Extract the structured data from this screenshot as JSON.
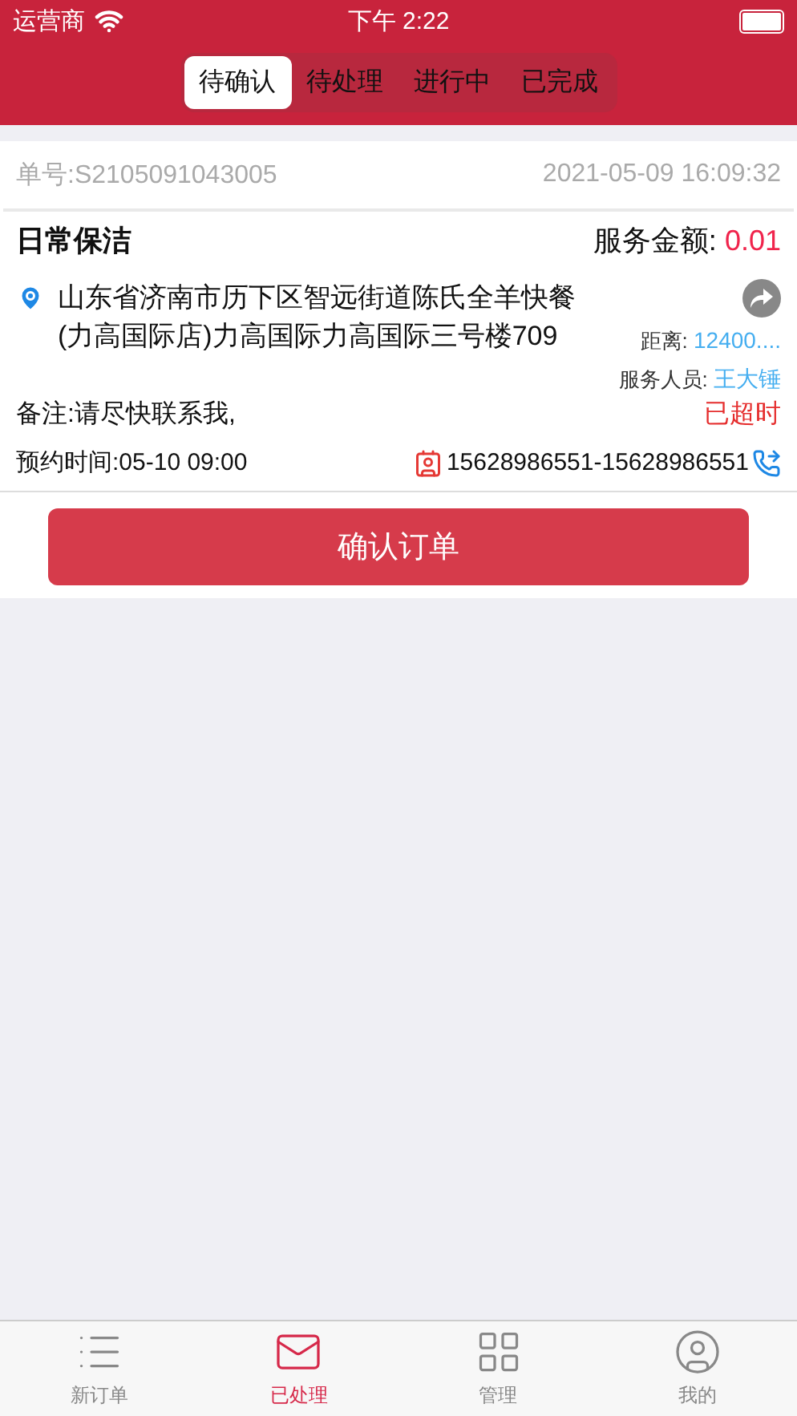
{
  "status_bar": {
    "carrier": "运营商",
    "time": "下午 2:22"
  },
  "segments": [
    {
      "label": "待确认",
      "selected": true
    },
    {
      "label": "待处理",
      "selected": false
    },
    {
      "label": "进行中",
      "selected": false
    },
    {
      "label": "已完成",
      "selected": false
    }
  ],
  "order": {
    "number": "单号:S2105091043005",
    "created": "2021-05-09 16:09:32",
    "service": "日常保洁",
    "amount_label": "服务金额:",
    "amount": "0.01",
    "address": "山东省济南市历下区智远街道陈氏全羊快餐(力高国际店)力高国际力高国际三号楼709",
    "distance_label": "距离:",
    "distance": "12400....",
    "staff_label": "服务人员:",
    "staff": "王大锤",
    "note": "备注:请尽快联系我,",
    "overdue": "已超时",
    "appointment": "预约时间:05-10 09:00",
    "phone": "15628986551-15628986551",
    "confirm_button": "确认订单"
  },
  "tab_bar": [
    {
      "label": "新订单",
      "selected": false,
      "kind": "list"
    },
    {
      "label": "已处理",
      "selected": true,
      "kind": "mail"
    },
    {
      "label": "管理",
      "selected": false,
      "kind": "grid"
    },
    {
      "label": "我的",
      "selected": false,
      "kind": "user"
    }
  ]
}
